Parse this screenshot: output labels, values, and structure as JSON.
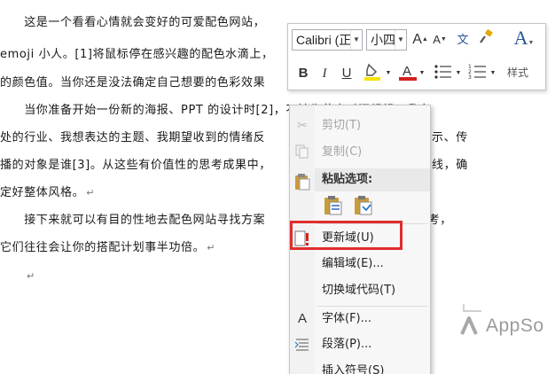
{
  "document": {
    "lines": [
      "　　这是一个看看心情就会变好的可爱配色网站，",
      "emoji 小人。[1]将鼠标停在感兴趣的配色水滴上，",
      "的颜色值。当你还是没法确定自己想要的色彩效果",
      "　　当你准备开始一份新的海报、PPT 的设计时[2]，不妨先花点时间想想：我身",
      "处的行业、我想表达的主题、我期望收到的情绪反",
      "播的对象是谁[3]。从这些有价值性的思考成果中，",
      "定好整体风格。",
      "　　接下来就可以有目的性地去配色网站寻找方案",
      "它们往往会让你的搭配计划事半功倍。",
      ""
    ],
    "right_fragments": {
      "line5": "示、传",
      "line6": "线，确",
      "line8": "思考，"
    },
    "paragraph_mark": "↵"
  },
  "mini_toolbar": {
    "font_name": "Calibri (正",
    "font_size": "小四",
    "styles_label": "样式",
    "grow_font": "A",
    "shrink_font": "A",
    "bold": "B",
    "italic": "I",
    "underline": "U",
    "font_color": "A",
    "highlight_color": "#f5e400",
    "font_color_value": "#d42020",
    "pinyin_glyph": "文"
  },
  "context_menu": {
    "cut": "剪切(T)",
    "copy": "复制(C)",
    "paste_options": "粘贴选项:",
    "update_field": "更新域(U)",
    "edit_field": "编辑域(E)...",
    "toggle_field_codes": "切换域代码(T)",
    "font": "字体(F)...",
    "paragraph": "段落(P)...",
    "insert_symbol": "插入符号(S)"
  },
  "watermark": {
    "text": "AppSo"
  }
}
